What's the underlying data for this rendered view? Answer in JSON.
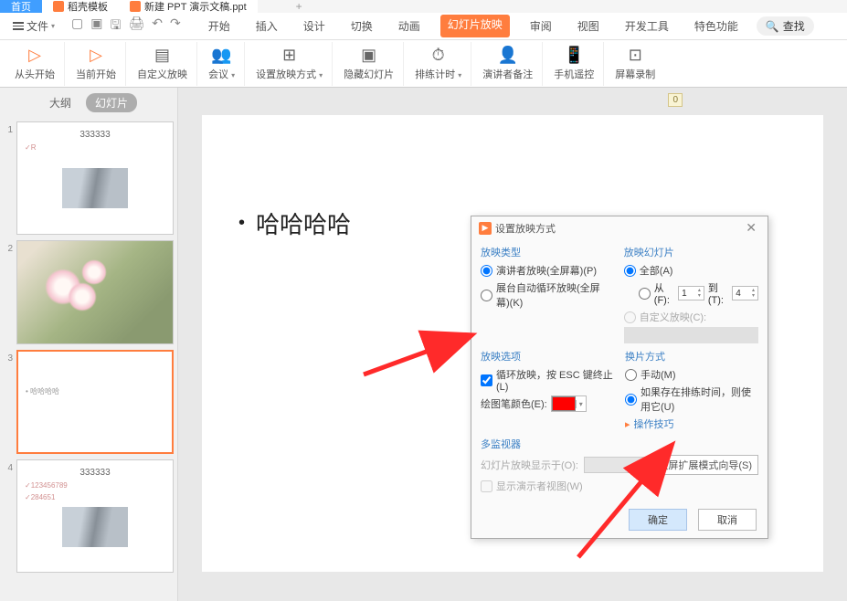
{
  "tabs": {
    "home": "首页",
    "template": "稻壳模板",
    "doc": "新建 PPT 演示文稿.ppt"
  },
  "file_menu": "文件",
  "menu": {
    "start": "开始",
    "insert": "插入",
    "design": "设计",
    "transition": "切换",
    "animation": "动画",
    "slideshow": "幻灯片放映",
    "review": "审阅",
    "view": "视图",
    "dev": "开发工具",
    "special": "特色功能",
    "search": "查找"
  },
  "ribbon": {
    "from_start": "从头开始",
    "from_current": "当前开始",
    "custom": "自定义放映",
    "meeting": "会议",
    "setup": "设置放映方式",
    "hide": "隐藏幻灯片",
    "rehearse": "排练计时",
    "presenter": "演讲者备注",
    "phone": "手机遥控",
    "record": "屏幕录制"
  },
  "sidebar": {
    "outline": "大纲",
    "slides": "幻灯片"
  },
  "thumbs": {
    "t1_title": "333333",
    "t1_sub": "✓R",
    "t3_text": "• 哈哈哈哈",
    "t4_title": "333333",
    "t4_s1": "✓123456789",
    "t4_s2": "✓284651"
  },
  "canvas": {
    "bullet": "哈哈哈哈",
    "page_ind": "0"
  },
  "dialog": {
    "title": "设置放映方式",
    "type_section": "放映类型",
    "type_presenter": "演讲者放映(全屏幕)(P)",
    "type_kiosk": "展台自动循环放映(全屏幕)(K)",
    "slides_section": "放映幻灯片",
    "slides_all": "全部(A)",
    "slides_from": "从(F):",
    "slides_from_val": "1",
    "slides_to": "到(T):",
    "slides_to_val": "4",
    "slides_custom": "自定义放映(C):",
    "options_section": "放映选项",
    "opt_loop": "循环放映，按 ESC 键终止(L)",
    "opt_pen_color": "绘图笔颜色(E):",
    "advance_section": "换片方式",
    "adv_manual": "手动(M)",
    "adv_timing": "如果存在排练时间，则使用它(U)",
    "tips": "操作技巧",
    "monitor_section": "多监视器",
    "monitor_display": "幻灯片放映显示于(O):",
    "monitor_dual": "双屏扩展模式向导(S)",
    "monitor_presenter": "显示演示者视图(W)",
    "ok": "确定",
    "cancel": "取消"
  }
}
